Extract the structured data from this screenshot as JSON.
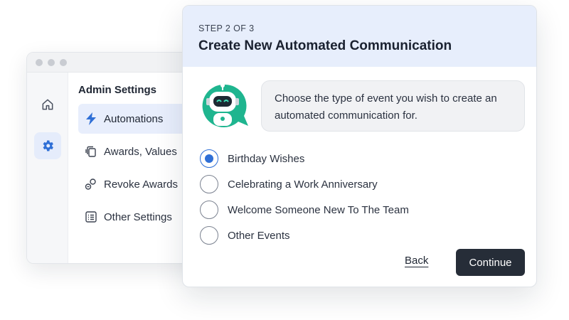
{
  "admin": {
    "title": "Admin Settings",
    "rail": [
      {
        "icon": "home-icon"
      },
      {
        "icon": "gear-icon",
        "active": true
      }
    ],
    "menu": [
      {
        "label": "Automations",
        "icon": "lightning-icon",
        "active": true
      },
      {
        "label": "Awards, Values",
        "icon": "cards-icon"
      },
      {
        "label": "Revoke Awards",
        "icon": "revoke-icon"
      },
      {
        "label": "Other Settings",
        "icon": "settings-list-icon"
      }
    ]
  },
  "dialog": {
    "step": "STEP 2 OF 3",
    "title": "Create New Automated Communication",
    "prompt": "Choose the type of event you wish to create an automated communication for.",
    "options": [
      {
        "label": "Birthday Wishes",
        "selected": true
      },
      {
        "label": "Celebrating a Work Anniversary",
        "selected": false
      },
      {
        "label": "Welcome Someone New To The Team",
        "selected": false
      },
      {
        "label": "Other Events",
        "selected": false
      }
    ],
    "back_label": "Back",
    "continue_label": "Continue"
  },
  "colors": {
    "accent": "#2f6fd6",
    "header_bg": "#e7eefc",
    "primary_button": "#262d38",
    "bot_green": "#1fb58f"
  }
}
